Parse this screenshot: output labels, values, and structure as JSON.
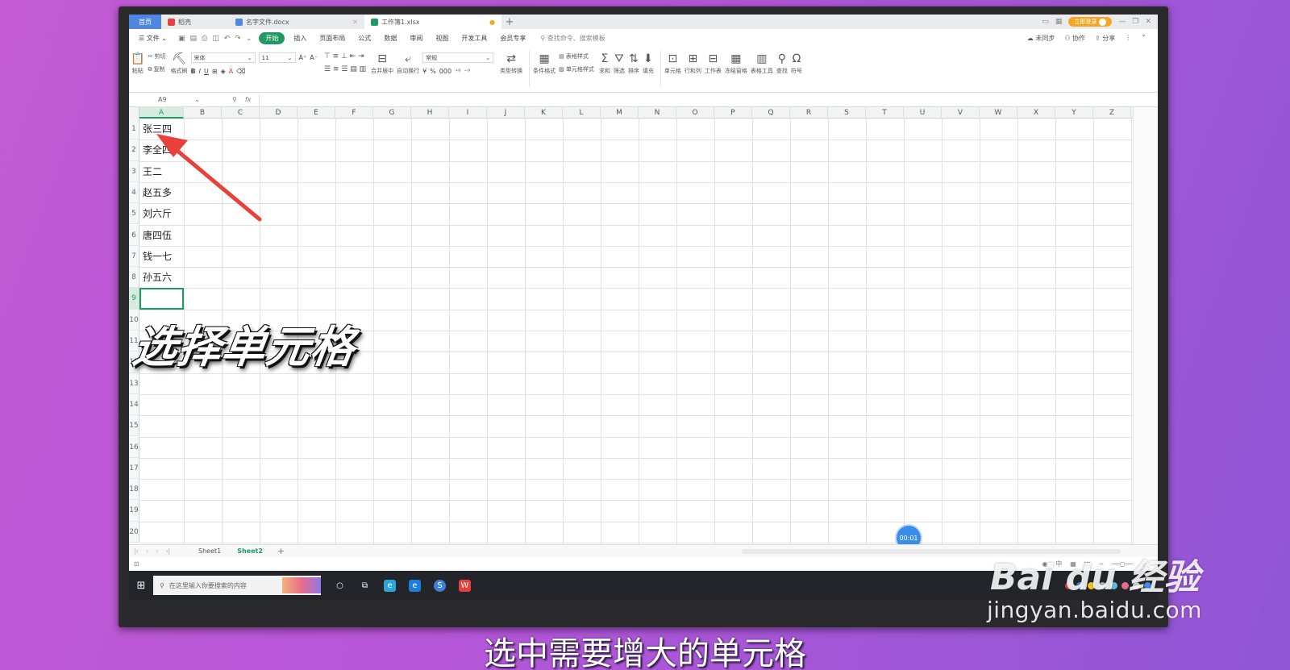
{
  "tabs": [
    {
      "label": "首页",
      "type": "home"
    },
    {
      "label": "稻壳",
      "type": "app"
    },
    {
      "label": "名字文件.docx",
      "type": "doc"
    },
    {
      "label": "工作簿1.xlsx",
      "type": "sheet"
    }
  ],
  "title_right": {
    "login": "立即登录"
  },
  "menu": {
    "file": "文件",
    "items": [
      "开始",
      "插入",
      "页面布局",
      "公式",
      "数据",
      "审阅",
      "视图",
      "开发工具",
      "会员专享"
    ],
    "active": "开始",
    "search": "查找命令、搜索模板",
    "right": [
      "未同步",
      "协作",
      "分享"
    ]
  },
  "ribbon": {
    "paste": "粘贴",
    "cut": "剪切",
    "copy": "复制",
    "format_painter": "格式刷",
    "font_name": "宋体",
    "font_size": "11",
    "merge": "合并居中",
    "wrap": "自动换行",
    "number_format": "常规",
    "type_convert": "类型转换",
    "cond_format": "条件格式",
    "table_style": "表格样式",
    "cell_style": "单元格样式",
    "sum": "求和",
    "filter": "筛选",
    "sort": "排序",
    "fill": "填充",
    "cell": "单元格",
    "rowcol": "行和列",
    "worksheet": "工作表",
    "freeze": "冻结窗格",
    "table_tools": "表格工具",
    "find": "查找",
    "symbol": "符号"
  },
  "formula_bar": {
    "name_box": "A9",
    "fx": "fx",
    "value": ""
  },
  "columns": [
    "A",
    "B",
    "C",
    "D",
    "E",
    "F",
    "G",
    "H",
    "I",
    "J",
    "K",
    "L",
    "M",
    "N",
    "O",
    "P",
    "Q",
    "R",
    "S",
    "T",
    "U",
    "V",
    "W",
    "X",
    "Y",
    "Z"
  ],
  "rows": [
    "1",
    "2",
    "3",
    "4",
    "5",
    "6",
    "7",
    "8",
    "9",
    "10",
    "11",
    "12",
    "13",
    "14",
    "15",
    "16",
    "17",
    "18",
    "19",
    "20"
  ],
  "cells_A": [
    "张三四",
    "李全四",
    "王二",
    "赵五多",
    "刘六斤",
    "唐四伍",
    "钱一七",
    "孙五六"
  ],
  "selected_cell": "A9",
  "sheets": [
    "Sheet1",
    "Sheet2"
  ],
  "active_sheet": "Sheet2",
  "timer": "00:01",
  "taskbar_search": "在这里输入你要搜索的内容",
  "overlay_text": "选择单元格",
  "caption": "选中需要增大的单元格",
  "watermark": {
    "logo": "Bai du 经验",
    "url": "jingyan.baidu.com"
  },
  "colors": {
    "accent": "#1e9b62",
    "home_tab": "#4e86e0",
    "arrow": "#e8413c",
    "timer": "#3c8dea",
    "background": "#b556d8"
  }
}
